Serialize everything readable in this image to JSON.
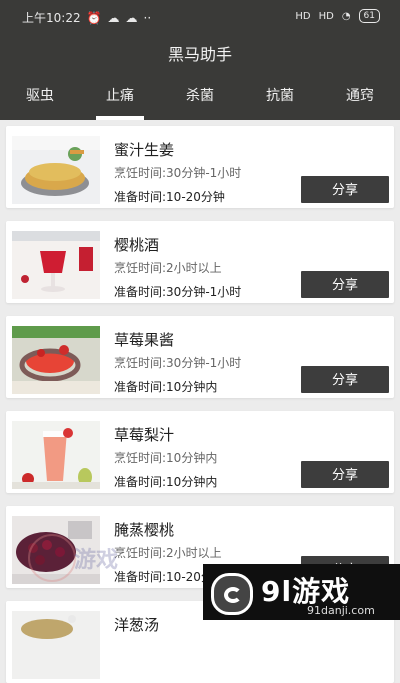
{
  "status_bar": {
    "time": "上午10:22",
    "notification_icons": [
      "alarm-icon",
      "wechat-icon",
      "wechat-icon",
      "more-dots-icon"
    ],
    "signal1": "HD",
    "signal2": "HD",
    "wifi": "wifi-icon",
    "battery": "61"
  },
  "app": {
    "title": "黑马助手"
  },
  "tabs": [
    {
      "label": "驱虫",
      "active": false
    },
    {
      "label": "止痛",
      "active": true
    },
    {
      "label": "杀菌",
      "active": false
    },
    {
      "label": "抗菌",
      "active": false
    },
    {
      "label": "通窍",
      "active": false
    }
  ],
  "recipes": [
    {
      "title": "蜜汁生姜",
      "cook_time": "烹饪时间:30分钟-1小时",
      "prep_time": "准备时间:10-20分钟",
      "share_label": "分享"
    },
    {
      "title": "樱桃酒",
      "cook_time": "烹饪时间:2小时以上",
      "prep_time": "准备时间:30分钟-1小时",
      "share_label": "分享"
    },
    {
      "title": "草莓果酱",
      "cook_time": "烹饪时间:30分钟-1小时",
      "prep_time": "准备时间:10分钟内",
      "share_label": "分享"
    },
    {
      "title": "草莓梨汁",
      "cook_time": "烹饪时间:10分钟内",
      "prep_time": "准备时间:10分钟内",
      "share_label": "分享"
    },
    {
      "title": "腌蒸樱桃",
      "cook_time": "烹饪时间:2小时以上",
      "prep_time": "准备时间:10-20分钟",
      "share_label": "分享"
    },
    {
      "title": "洋葱汤",
      "cook_time": "",
      "prep_time": "",
      "share_label": ""
    }
  ],
  "watermark": {
    "brand": "9l游戏",
    "url": "91danji.com"
  },
  "faint_watermark": {
    "text": "游戏"
  }
}
